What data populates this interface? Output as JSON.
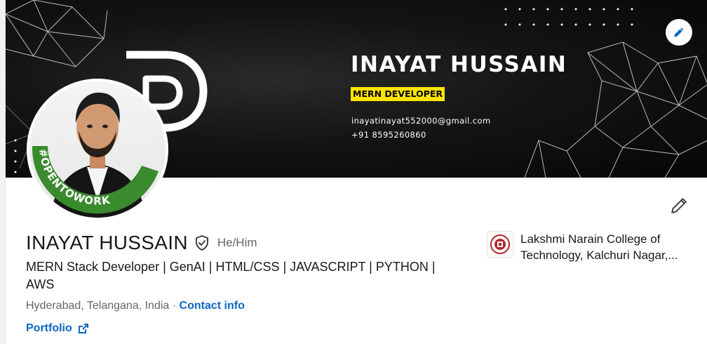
{
  "banner": {
    "name": "INAYAT HUSSAIN",
    "role": "MERN DEVELOPER",
    "email": "inayatinayat552000@gmail.com",
    "phone": "+91 8595260860"
  },
  "avatar": {
    "badge_text": "#OPENTOWORK"
  },
  "profile": {
    "name": "INAYAT HUSSAIN",
    "pronouns": "He/Him",
    "headline": "MERN Stack Developer | GenAI | HTML/CSS | JAVASCRIPT | PYTHON | AWS",
    "location": "Hyderabad, Telangana, India",
    "separator": " · ",
    "contact_info": "Contact info",
    "portfolio": "Portfolio"
  },
  "education": {
    "school": "Lakshmi Narain College of Technology, Kalchuri Nagar,..."
  },
  "icons": {
    "banner_edit": "pencil-icon",
    "profile_edit": "pencil-icon",
    "verified": "shield-check-icon",
    "external_link": "external-link-icon",
    "school_logo": "college-crest-icon"
  },
  "colors": {
    "link": "#0a66c2",
    "open_to_work": "#3a8a2e",
    "banner_highlight": "#ffe500"
  }
}
